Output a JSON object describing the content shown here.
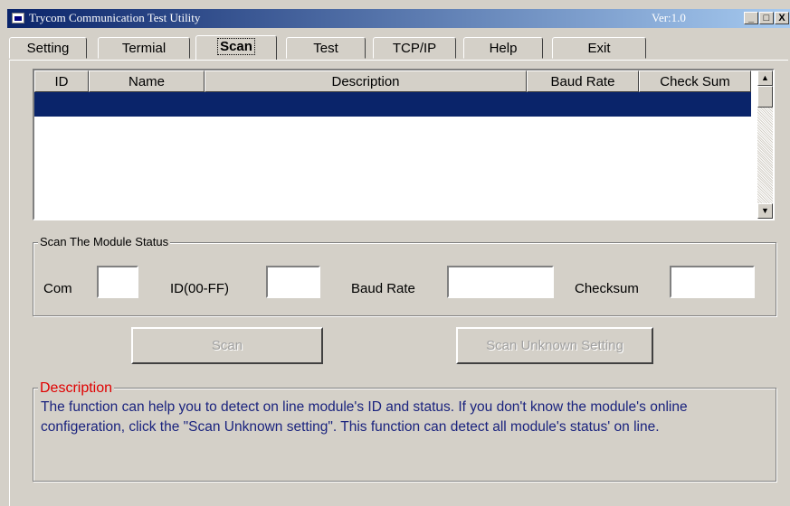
{
  "window": {
    "title": "Trycom Communication Test Utility",
    "version": "Ver:1.0",
    "controls": {
      "minimize": "_",
      "maximize": "□",
      "close": "X"
    }
  },
  "tabs": [
    {
      "label": "Setting",
      "active": false
    },
    {
      "label": "Termial",
      "active": false
    },
    {
      "label": "Scan",
      "active": true
    },
    {
      "label": "Test",
      "active": false
    },
    {
      "label": "TCP/IP",
      "active": false
    },
    {
      "label": "Help",
      "active": false
    },
    {
      "label": "Exit",
      "active": false
    }
  ],
  "grid": {
    "columns": [
      "ID",
      "Name",
      "Description",
      "Baud Rate",
      "Check Sum"
    ],
    "rows": [],
    "scroll_up": "▲",
    "scroll_down": "▼"
  },
  "status": {
    "legend": "Scan The Module Status",
    "com_label": "Com",
    "com_value": "",
    "id_label": "ID(00-FF)",
    "id_value": "",
    "baud_label": "Baud Rate",
    "baud_value": "",
    "checksum_label": "Checksum",
    "checksum_value": ""
  },
  "buttons": {
    "scan": "Scan",
    "scan_unknown": "Scan Unknown Setting"
  },
  "description": {
    "legend": "Description",
    "text": "The function can help you to detect on line module's ID and status. If you don't know the module's online configeration, click the \"Scan Unknown setting\". This function can detect all module's status' on line."
  },
  "colors": {
    "titlebar_start": "#0a246a",
    "titlebar_end": "#a6caf0",
    "selected_row": "#0a246a",
    "description_legend": "#e00000",
    "description_text": "#1a237e",
    "face": "#d4d0c8"
  }
}
